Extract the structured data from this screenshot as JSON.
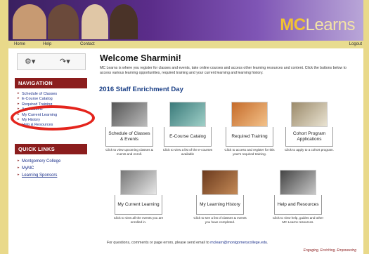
{
  "app": {
    "logo_mc": "MC",
    "logo_learns": "Learns"
  },
  "nav": {
    "home": "Home",
    "help": "Help",
    "contact": "Contact",
    "logout": "Logout"
  },
  "toolbar": {
    "gear_icon": "gear-icon",
    "refresh_icon": "refresh-icon"
  },
  "sidebar": {
    "navigation_header": "NAVIGATION",
    "navigation_items": [
      "Schedule of Classes",
      "E-Course Catalog",
      "Required Training",
      "Applications",
      "My Current Learning",
      "My History",
      "Help & Resources"
    ],
    "quicklinks_header": "QUICK LINKS",
    "quicklinks_items": [
      "Montgomery College",
      "MyMC",
      "Learning Sponsors"
    ]
  },
  "main": {
    "title": "Welcome Sharmini!",
    "intro": "MC Learns is where you register for classes and events, take online courses and access other learning resources and content. Click the buttons below to access various learning opportunities, required training and your current learning and learning history.",
    "subheading": "2016 Staff Enrichment Day",
    "tiles": [
      {
        "label": "Schedule of Classes & Events",
        "desc": "Click to view upcoming classes & events and enroll."
      },
      {
        "label": "E-Course Catalog",
        "desc": "Click to view a list of the e-courses available"
      },
      {
        "label": "Required Training",
        "desc": "Click to access and register for this year's required training."
      },
      {
        "label": "Cohort Program Applications",
        "desc": "Click to apply to a cohort program."
      },
      {
        "label": "My Current Learning",
        "desc": "Click to view all the events you are enrolled in."
      },
      {
        "label": "My Learning History",
        "desc": "Click to see a list of classes & events you have completed."
      },
      {
        "label": "Help and Resources",
        "desc": "Click to view help, guides and other MC Learns resources."
      }
    ]
  },
  "footer": {
    "text": "For questions, comments or page errors, please send email to",
    "email": "mclearn@montgomerycollege.edu",
    "tagline": "Engaging, Enriching, Empowering"
  },
  "colors": {
    "accent": "#8b1d1d",
    "link": "#1a2f8a",
    "banner": "#5b2d8a",
    "annotation": "#e4241c"
  }
}
